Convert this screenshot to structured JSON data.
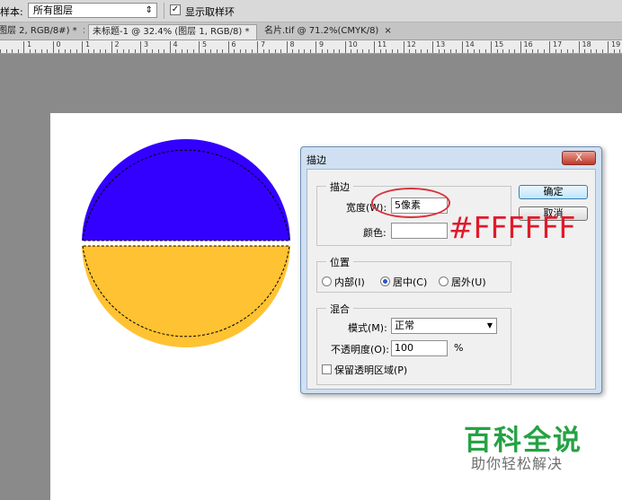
{
  "options_bar": {
    "sample_label": "样本:",
    "sample_value": "所有图层",
    "show_ring_checked": true,
    "show_ring_label": "显示取样环"
  },
  "tabs": [
    {
      "label": "图层 2, RGB/8#) *",
      "close": "×"
    },
    {
      "label": "未标题-1 @ 32.4% (图层 1, RGB/8) *",
      "close": "×"
    },
    {
      "label": "名片.tif @ 71.2%(CMYK/8)",
      "close": "×"
    }
  ],
  "ruler": {
    "numbers": [
      "1",
      "0",
      "1",
      "2",
      "3",
      "4",
      "5",
      "6",
      "7",
      "8",
      "9",
      "10",
      "11",
      "12",
      "13",
      "14",
      "15",
      "16",
      "17",
      "18",
      "19"
    ]
  },
  "canvas": {
    "circle_colors": {
      "top": "#3300ff",
      "bottom": "#ffc232"
    }
  },
  "dialog": {
    "title": "描边",
    "close": "X",
    "stroke_group": "描边",
    "width_label": "宽度(W):",
    "width_value": "5像素",
    "color_label": "颜色:",
    "color_value": "#ffffff",
    "position_group": "位置",
    "inside_label": "内部(I)",
    "center_label": "居中(C)",
    "outside_label": "居外(U)",
    "position_selected": "center",
    "blend_group": "混合",
    "mode_label": "模式(M):",
    "mode_value": "正常",
    "opacity_label": "不透明度(O):",
    "opacity_value": "100",
    "opacity_unit": "%",
    "preserve_label": "保留透明区域(P)",
    "preserve_checked": false,
    "ok_label": "确定",
    "cancel_label": "取消"
  },
  "annotation": {
    "text": "#FFFFFF",
    "color": "#e01a2a"
  },
  "watermark": {
    "title": "百科全说",
    "subtitle": "助你轻松解决"
  }
}
